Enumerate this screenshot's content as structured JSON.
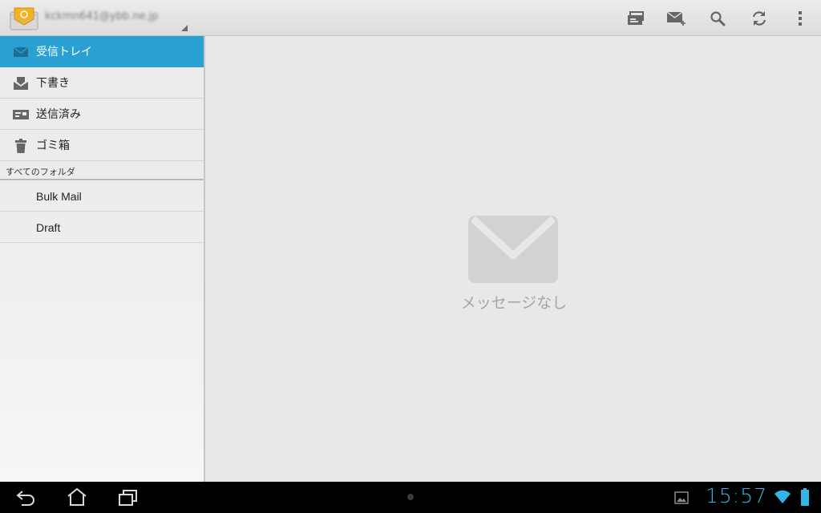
{
  "header": {
    "account": "kckmn641@ybb.ne.jp",
    "actions": [
      "combined-view",
      "compose",
      "search",
      "refresh",
      "overflow"
    ]
  },
  "sidebar": {
    "items": [
      {
        "label": "受信トレイ",
        "icon": "inbox-icon",
        "selected": true
      },
      {
        "label": "下書き",
        "icon": "drafts-icon",
        "selected": false
      },
      {
        "label": "送信済み",
        "icon": "sent-icon",
        "selected": false
      },
      {
        "label": "ゴミ箱",
        "icon": "trash-icon",
        "selected": false
      }
    ],
    "section_title": "すべてのフォルダ",
    "folders": [
      "Bulk Mail",
      "Draft"
    ]
  },
  "main": {
    "empty_text": "メッセージなし"
  },
  "statusbar": {
    "time": "15:57"
  },
  "colors": {
    "accent": "#2aa1d2",
    "clock": "#33b5e5",
    "empty": "#d2d2d2"
  }
}
